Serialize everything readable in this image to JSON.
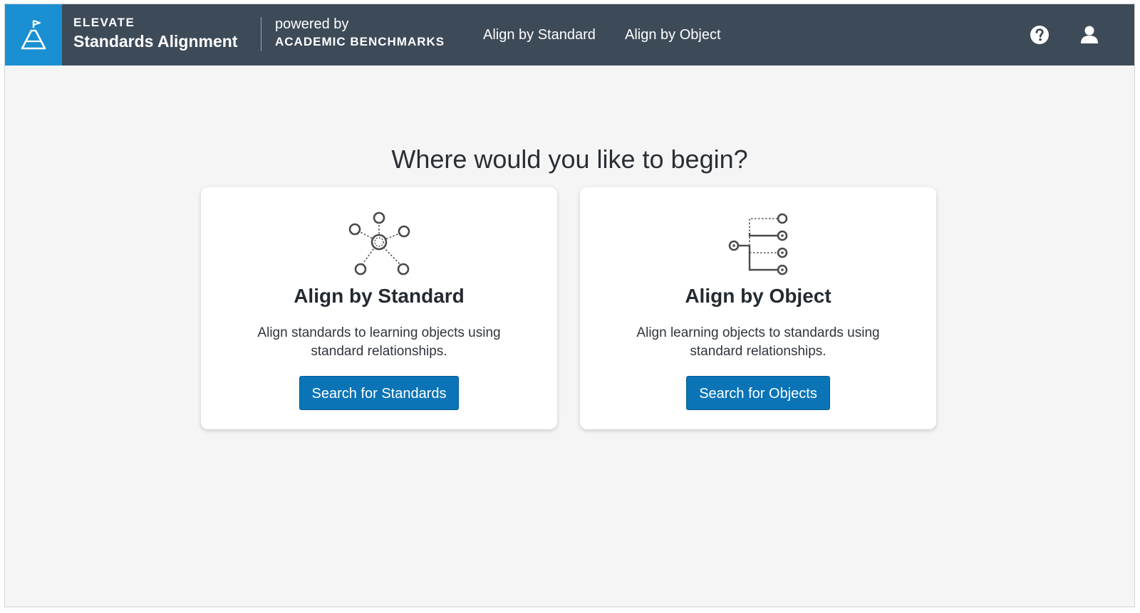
{
  "header": {
    "brand_top": "ELEVATE",
    "brand_bottom": "Standards Alignment",
    "powered_top": "powered by",
    "powered_bottom": "ACADEMIC BENCHMARKS",
    "nav": [
      {
        "label": "Align by Standard"
      },
      {
        "label": "Align by Object"
      }
    ],
    "icons": {
      "logo": "flask-flag-icon",
      "help": "help-circle-icon",
      "user": "user-avatar-icon"
    }
  },
  "main": {
    "headline": "Where would you like to begin?",
    "cards": [
      {
        "icon": "network-nodes-icon",
        "title": "Align by Standard",
        "description": "Align standards to learning objects using standard relationships.",
        "button": "Search for Standards"
      },
      {
        "icon": "branching-tree-icon",
        "title": "Align by Object",
        "description": "Align learning objects to standards using standard relationships.",
        "button": "Search for Objects"
      }
    ]
  },
  "colors": {
    "topbar": "#3d4a58",
    "logo_block": "#1a8fd1",
    "primary_button": "#0a74b7",
    "page_background": "#f5f5f5"
  }
}
